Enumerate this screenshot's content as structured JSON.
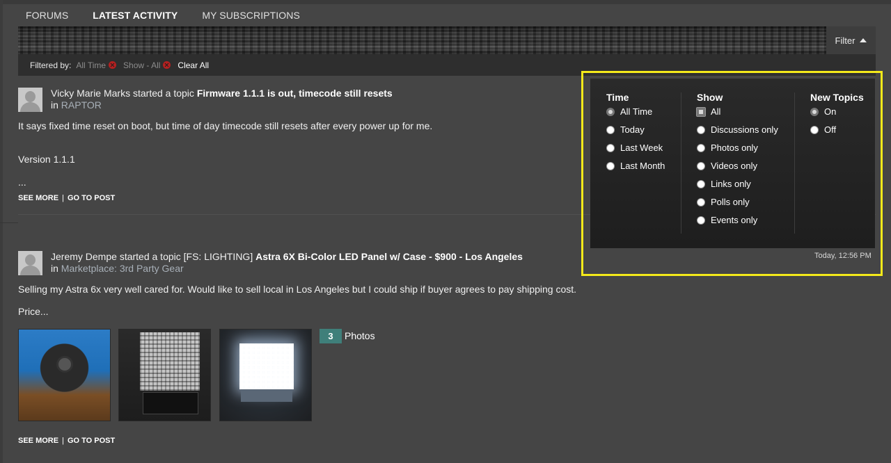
{
  "tabs": [
    {
      "label": "FORUMS"
    },
    {
      "label": "LATEST ACTIVITY"
    },
    {
      "label": "MY SUBSCRIPTIONS"
    }
  ],
  "filter_button": {
    "label": "Filter"
  },
  "filter_bar": {
    "label": "Filtered by:",
    "chips": [
      {
        "label": "All Time"
      },
      {
        "label": "Show - All"
      }
    ],
    "clear_label": "Clear All"
  },
  "posts": [
    {
      "author": "Vicky Marie Marks",
      "action": "started a topic",
      "prefix": "",
      "title": "Firmware 1.1.1 is out, timecode still resets",
      "in_label": "in",
      "forum": "RAPTOR",
      "lines": [
        "It says fixed time reset on boot, but time of day timecode still resets after every power up for me.",
        "Version 1.1.1",
        "..."
      ],
      "see_more": "SEE MORE",
      "separator": "|",
      "go_to_post": "GO TO POST"
    },
    {
      "author": "Jeremy Dempe",
      "action": "started a topic",
      "prefix": "[FS: LIGHTING]",
      "title": "Astra 6X Bi-Color LED Panel w/ Case - $900 - Los Angeles",
      "in_label": "in",
      "forum": "Marketplace: 3rd Party Gear",
      "lines": [
        "Selling my Astra 6x very well cared for. Would like to sell local in Los Angeles but I could ship if buyer agrees to pay shipping cost.",
        "Price..."
      ],
      "photo_count": "3",
      "photo_label": "Photos",
      "see_more": "SEE MORE",
      "separator": "|",
      "go_to_post": "GO TO POST"
    }
  ],
  "filter_popup": {
    "time": {
      "heading": "Time",
      "options": [
        "All Time",
        "Today",
        "Last Week",
        "Last Month"
      ],
      "selected": "All Time"
    },
    "show": {
      "heading": "Show",
      "options": [
        "All",
        "Discussions only",
        "Photos only",
        "Videos only",
        "Links only",
        "Polls only",
        "Events only"
      ],
      "selected": "All"
    },
    "new_topics": {
      "heading": "New Topics",
      "options": [
        "On",
        "Off"
      ],
      "selected": "On"
    }
  },
  "timestamp": "Today, 12:56 PM",
  "colors": {
    "background": "#454545",
    "highlight": "#f4e91a",
    "photo_badge": "#3f7f7a",
    "remove_chip": "#b52020"
  }
}
